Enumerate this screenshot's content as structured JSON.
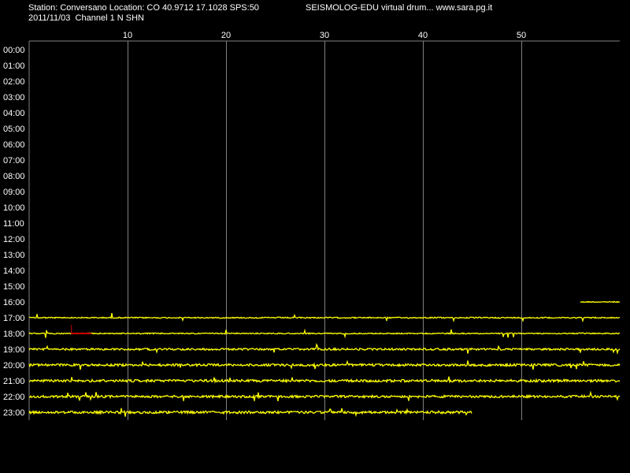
{
  "header": {
    "station_line": "Station: Conversano Location: CO 40.9712 17.1028 SPS:50",
    "software_line": "SEISMOLOG-EDU virtual drum... www.sara.pg.it",
    "date_line": "2011/11/03  Channel 1 N SHN"
  },
  "colors": {
    "background": "#000000",
    "trace": "#ffff00",
    "event_marker": "#cc0000",
    "grid": "#808080",
    "text": "#ffffff"
  },
  "chart_data": {
    "type": "line",
    "title": "",
    "xlabel": "",
    "ylabel": "",
    "x_unit": "minutes",
    "xlim": [
      0,
      60
    ],
    "x_ticks": [
      10,
      20,
      30,
      40,
      50
    ],
    "hour_labels": [
      "00:00",
      "01:00",
      "02:00",
      "03:00",
      "04:00",
      "05:00",
      "06:00",
      "07:00",
      "08:00",
      "09:00",
      "10:00",
      "11:00",
      "12:00",
      "13:00",
      "14:00",
      "15:00",
      "16:00",
      "17:00",
      "18:00",
      "19:00",
      "20:00",
      "21:00",
      "22:00",
      "23:00"
    ],
    "grid": "vertical",
    "traces": [
      {
        "hour": "16:00",
        "start_min": 56,
        "end_min": 60,
        "activity": 0.1
      },
      {
        "hour": "17:00",
        "start_min": 0,
        "end_min": 60,
        "activity": 0.2
      },
      {
        "hour": "18:00",
        "start_min": 0,
        "end_min": 60,
        "activity": 0.15
      },
      {
        "hour": "19:00",
        "start_min": 0,
        "end_min": 60,
        "activity": 0.6
      },
      {
        "hour": "20:00",
        "start_min": 0,
        "end_min": 60,
        "activity": 0.8
      },
      {
        "hour": "21:00",
        "start_min": 0,
        "end_min": 60,
        "activity": 0.9
      },
      {
        "hour": "22:00",
        "start_min": 0,
        "end_min": 60,
        "activity": 0.8
      },
      {
        "hour": "23:00",
        "start_min": 0,
        "end_min": 45,
        "activity": 0.9
      }
    ],
    "event_markers": [
      {
        "hour": "18:00",
        "start_min": 4.3,
        "end_min": 6.3
      }
    ]
  }
}
